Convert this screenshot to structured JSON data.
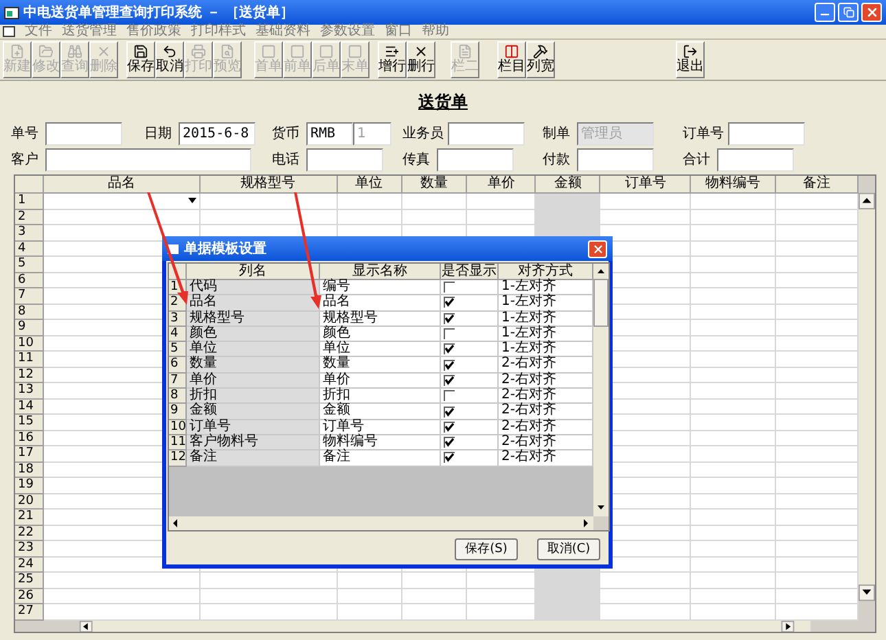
{
  "window": {
    "title": "中电送货单管理查询打印系统 － ［送货单］"
  },
  "menu": [
    "文件",
    "送货管理",
    "售价政策",
    "打印样式",
    "基础资料",
    "参数设置",
    "窗口",
    "帮助"
  ],
  "toolbar": [
    [
      {
        "label": "新建",
        "disabled": true
      },
      {
        "label": "修改",
        "disabled": true
      },
      {
        "label": "查询",
        "disabled": true
      },
      {
        "label": "删除",
        "disabled": true
      }
    ],
    [
      {
        "label": "保存",
        "disabled": false
      },
      {
        "label": "取消",
        "disabled": false
      },
      {
        "label": "打印",
        "disabled": true
      },
      {
        "label": "预览",
        "disabled": true
      }
    ],
    [
      {
        "label": "首单",
        "disabled": true
      },
      {
        "label": "前单",
        "disabled": true
      },
      {
        "label": "后单",
        "disabled": true
      },
      {
        "label": "末单",
        "disabled": true
      }
    ],
    [
      {
        "label": "增行",
        "disabled": false
      },
      {
        "label": "删行",
        "disabled": false
      }
    ],
    [
      {
        "label": "栏二",
        "disabled": true
      }
    ],
    [
      {
        "label": "栏目",
        "disabled": false
      },
      {
        "label": "列宽",
        "disabled": false
      }
    ],
    [
      {
        "label": "退出",
        "disabled": false
      }
    ]
  ],
  "form": {
    "title": "送货单",
    "rows": [
      [
        {
          "label": "单号",
          "disabled": false
        },
        {
          "label": "日期",
          "value": "2015-6-8",
          "disabled": false
        },
        {
          "label": "货币",
          "value": "RMB",
          "rate": "1",
          "disabled": false
        },
        {
          "label": "业务员",
          "disabled": false
        },
        {
          "label": "制单",
          "value": "管理员",
          "disabled": true
        },
        {
          "label": "订单号",
          "disabled": false
        }
      ],
      [
        {
          "label": "客户",
          "disabled": false
        },
        null,
        {
          "label": "电话",
          "disabled": false
        },
        {
          "label": "传真",
          "disabled": false
        },
        {
          "label": "付款",
          "disabled": false
        },
        {
          "label": "合计",
          "disabled": false
        }
      ]
    ]
  },
  "table": {
    "columns": [
      {
        "label": "品名",
        "shaded": false
      },
      {
        "label": "规格型号",
        "shaded": false
      },
      {
        "label": "单位",
        "shaded": false
      },
      {
        "label": "数量",
        "shaded": false
      },
      {
        "label": "单价",
        "shaded": false
      },
      {
        "label": "金额",
        "shaded": true
      },
      {
        "label": "订单号",
        "shaded": false
      },
      {
        "label": "物料编号",
        "shaded": false
      },
      {
        "label": "备注",
        "shaded": false
      }
    ],
    "rows": [
      {
        "number": "1",
        "editing": true
      },
      {
        "number": "2",
        "editing": false
      },
      {
        "number": "3",
        "editing": false
      },
      {
        "number": "4",
        "editing": false
      },
      {
        "number": "5",
        "editing": false
      },
      {
        "number": "6",
        "editing": false
      },
      {
        "number": "7",
        "editing": false
      },
      {
        "number": "8",
        "editing": false
      },
      {
        "number": "9",
        "editing": false
      },
      {
        "number": "10",
        "editing": false
      },
      {
        "number": "11",
        "editing": false
      },
      {
        "number": "12",
        "editing": false
      },
      {
        "number": "13",
        "editing": false
      },
      {
        "number": "14",
        "editing": false
      },
      {
        "number": "15",
        "editing": false
      },
      {
        "number": "16",
        "editing": false
      },
      {
        "number": "17",
        "editing": false
      },
      {
        "number": "18",
        "editing": false
      },
      {
        "number": "19",
        "editing": false
      },
      {
        "number": "20",
        "editing": false
      },
      {
        "number": "21",
        "editing": false
      },
      {
        "number": "22",
        "editing": false
      },
      {
        "number": "23",
        "editing": false
      },
      {
        "number": "24",
        "editing": false
      },
      {
        "number": "25",
        "editing": false
      },
      {
        "number": "26",
        "editing": false
      },
      {
        "number": "27",
        "editing": false
      }
    ]
  },
  "dialog": {
    "title": "单据模板设置",
    "columns": [
      "列名",
      "显示名称",
      "是否显示",
      "对齐方式"
    ],
    "rows": [
      {
        "number": "1",
        "name": "代码",
        "display": "编号",
        "shown": false,
        "align": "1-左对齐"
      },
      {
        "number": "2",
        "name": "品名",
        "display": "品名",
        "shown": true,
        "align": "1-左对齐"
      },
      {
        "number": "3",
        "name": "规格型号",
        "display": "规格型号",
        "shown": true,
        "align": "1-左对齐"
      },
      {
        "number": "4",
        "name": "颜色",
        "display": "颜色",
        "shown": false,
        "align": "1-左对齐"
      },
      {
        "number": "5",
        "name": "单位",
        "display": "单位",
        "shown": true,
        "align": "1-左对齐"
      },
      {
        "number": "6",
        "name": "数量",
        "display": "数量",
        "shown": true,
        "align": "2-右对齐"
      },
      {
        "number": "7",
        "name": "单价",
        "display": "单价",
        "shown": true,
        "align": "2-右对齐"
      },
      {
        "number": "8",
        "name": "折扣",
        "display": "折扣",
        "shown": false,
        "align": "2-右对齐"
      },
      {
        "number": "9",
        "name": "金额",
        "display": "金额",
        "shown": true,
        "align": "2-右对齐"
      },
      {
        "number": "10",
        "name": "订单号",
        "display": "订单号",
        "shown": true,
        "align": "2-右对齐"
      },
      {
        "number": "11",
        "name": "客户物料号",
        "display": "物料编号",
        "shown": true,
        "align": "2-右对齐"
      },
      {
        "number": "12",
        "name": "备注",
        "display": "备注",
        "shown": true,
        "align": "2-右对齐"
      }
    ],
    "buttons": [
      "保存(S)",
      "取消(C)"
    ]
  }
}
